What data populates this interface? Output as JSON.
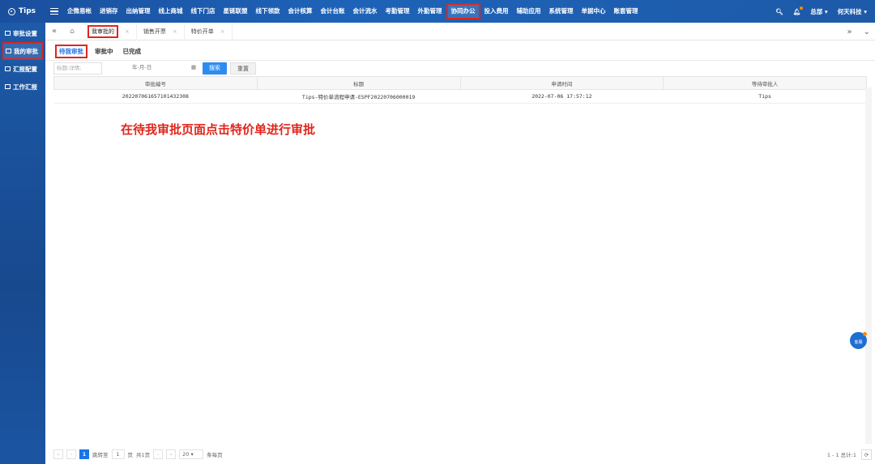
{
  "header": {
    "logo": "Tips",
    "nav": [
      "企微易帐",
      "进销存",
      "出纳管理",
      "线上商城",
      "线下门店",
      "星链联盟",
      "线下领款",
      "会计核算",
      "会计台账",
      "会计流水",
      "考勤管理",
      "外勤管理",
      "协同办公",
      "投入费用",
      "辅助应用",
      "系统管理",
      "单据中心",
      "账套管理"
    ],
    "active_nav": "协同办公",
    "user": "总部",
    "company": "何天科技"
  },
  "sidebar": {
    "items": [
      {
        "label": "审批设置",
        "icon": "monitor-icon"
      },
      {
        "label": "我的审批",
        "icon": "approval-icon"
      },
      {
        "label": "汇报配置",
        "icon": "report-config-icon"
      },
      {
        "label": "工作汇报",
        "icon": "report-icon"
      }
    ],
    "active": "我的审批"
  },
  "tabs": {
    "items": [
      {
        "label": "我审批的"
      },
      {
        "label": "销售开票"
      },
      {
        "label": "特价开单"
      }
    ]
  },
  "subtabs": [
    "待我审批",
    "审批中",
    "已完成"
  ],
  "search": {
    "placeholder": "标题;详情;",
    "date_placeholder": "年-月-日",
    "search_label": "搜索",
    "reset_label": "重置"
  },
  "table": {
    "columns": [
      "审批编号",
      "标题",
      "申请时间",
      "等待审批人"
    ],
    "rows": [
      [
        "20220706165710143230​8",
        "Tips-特价单流程申请-ESPF20220706000019",
        "2022-07-06 17:57:12",
        "Tips"
      ]
    ]
  },
  "annotation": "在待我审批页面点击特价单进行审批",
  "chat_label": "客服",
  "pager": {
    "current": "1",
    "goto_label": "跳转至",
    "page_input": "1",
    "page_unit": "页",
    "total_pages": "共1页",
    "page_size": "20",
    "per_page_label": "条每页",
    "summary": "1 - 1 总计:1"
  },
  "colors": {
    "accent": "#1a73e8",
    "highlight": "#e0261c",
    "header": "#1e63b8"
  }
}
